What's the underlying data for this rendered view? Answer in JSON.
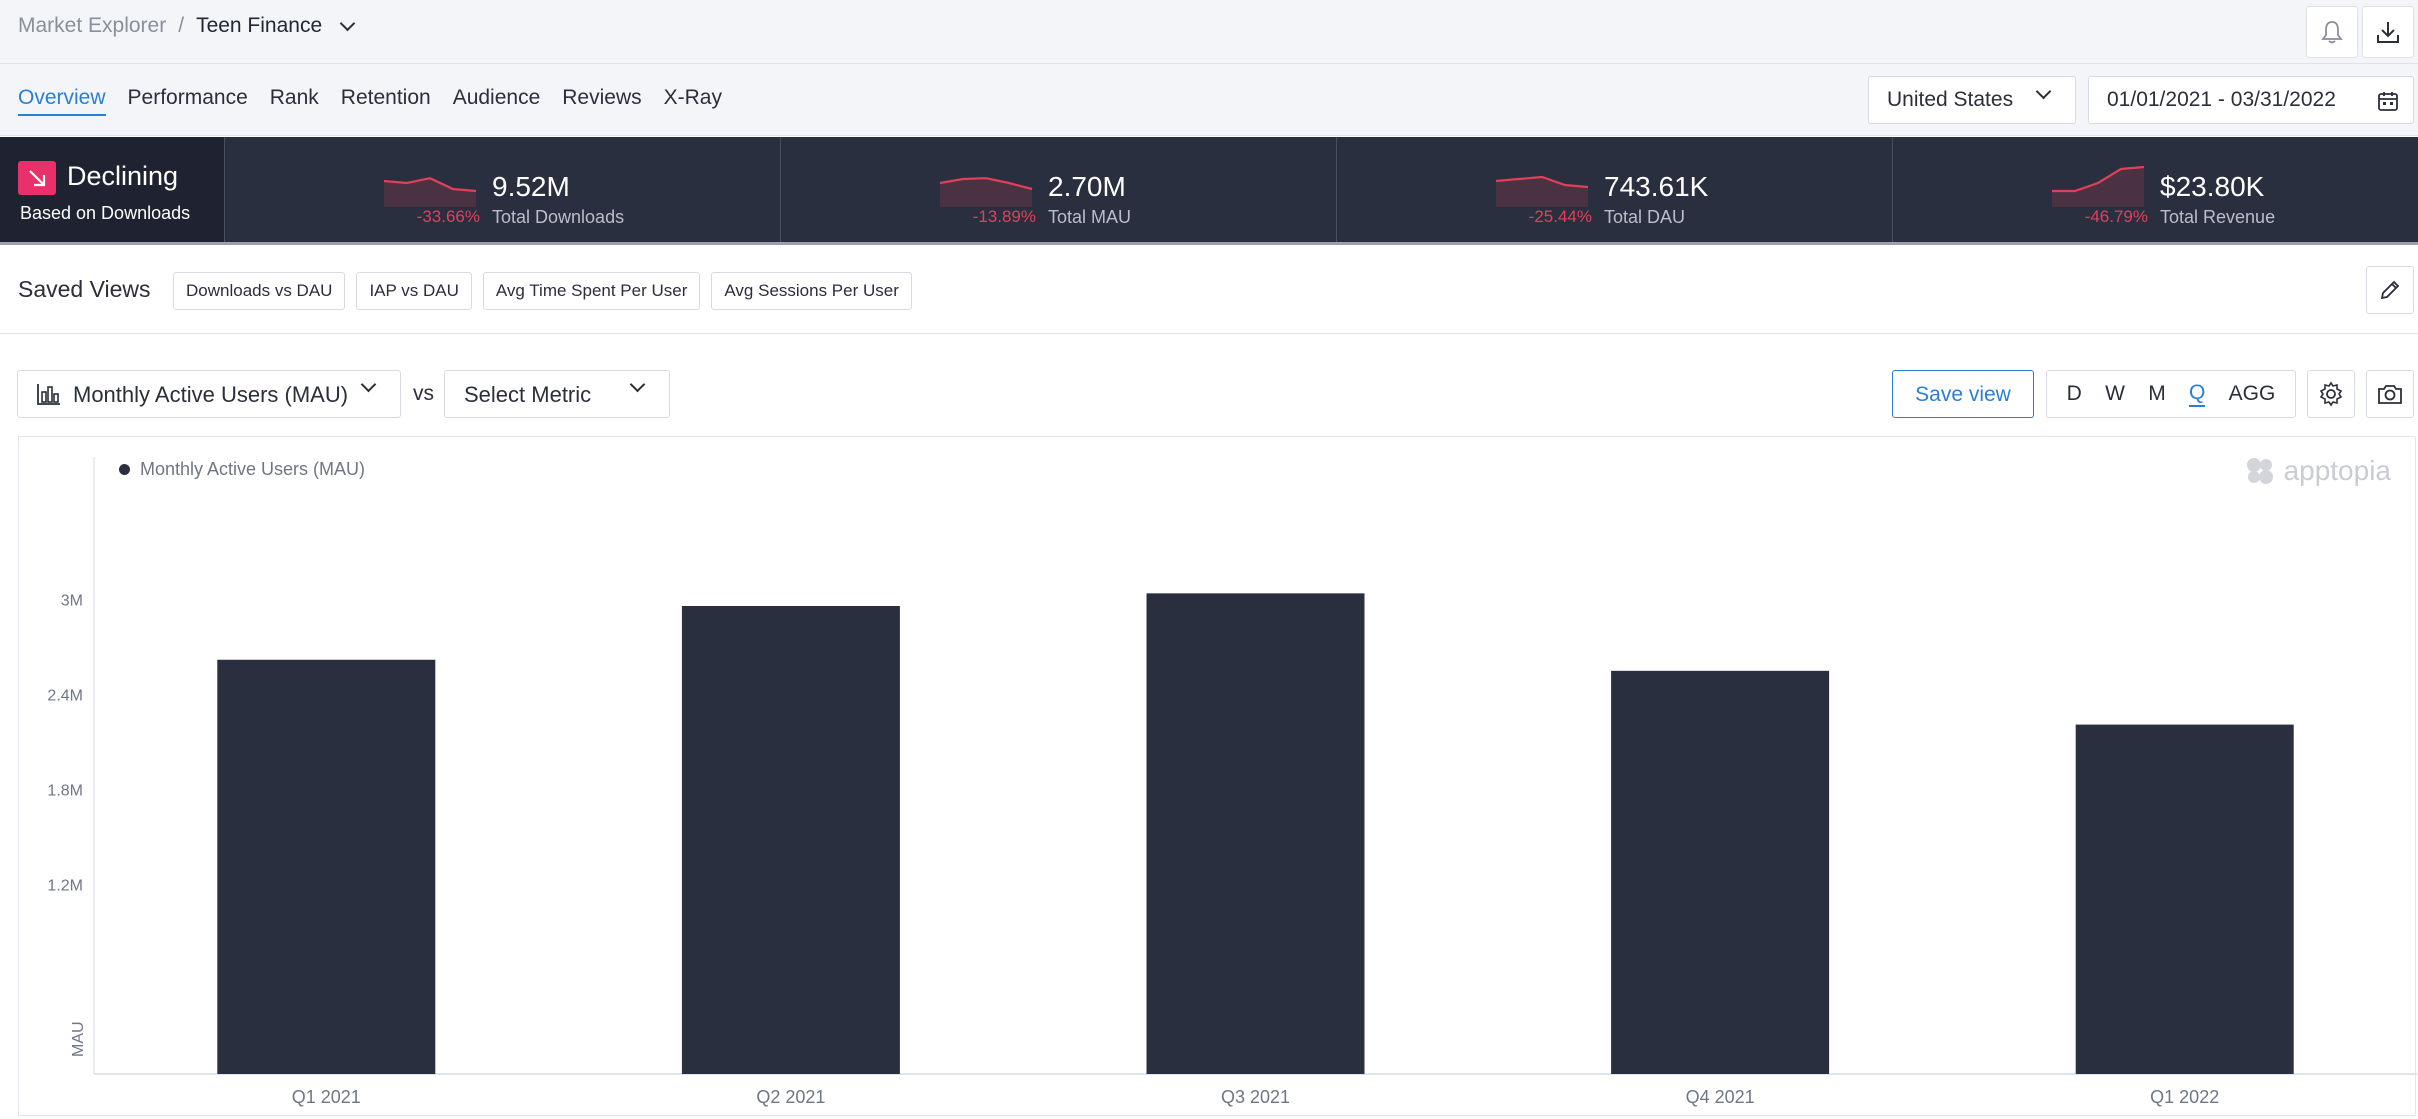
{
  "breadcrumb": {
    "root": "Market Explorer",
    "separator": "/",
    "current": "Teen Finance"
  },
  "top_icons": [
    "bell-icon",
    "download-icon"
  ],
  "tabs": [
    {
      "label": "Overview",
      "active": true
    },
    {
      "label": "Performance"
    },
    {
      "label": "Rank"
    },
    {
      "label": "Retention"
    },
    {
      "label": "Audience"
    },
    {
      "label": "Reviews"
    },
    {
      "label": "X-Ray"
    }
  ],
  "filters": {
    "country": "United States",
    "date_range": "01/01/2021 - 03/31/2022"
  },
  "trend": {
    "title": "Declining",
    "subtitle": "Based on Downloads",
    "icon": "arrow-down-right-icon",
    "color": "#e8306a"
  },
  "kpis": [
    {
      "pct": "-33.66%",
      "value": "9.52M",
      "label": "Total Downloads",
      "spark": [
        0.55,
        0.5,
        0.62,
        0.35,
        0.3
      ]
    },
    {
      "pct": "-13.89%",
      "value": "2.70M",
      "label": "Total MAU",
      "spark": [
        0.5,
        0.6,
        0.62,
        0.5,
        0.35
      ]
    },
    {
      "pct": "-25.44%",
      "value": "743.61K",
      "label": "Total DAU",
      "spark": [
        0.55,
        0.6,
        0.65,
        0.45,
        0.4
      ]
    },
    {
      "pct": "-46.79%",
      "value": "$23.80K",
      "label": "Total Revenue",
      "spark": [
        0.3,
        0.3,
        0.5,
        0.85,
        0.9
      ]
    }
  ],
  "saved_views": {
    "title": "Saved Views",
    "chips": [
      "Downloads vs DAU",
      "IAP vs DAU",
      "Avg Time Spent Per User",
      "Avg Sessions Per User"
    ]
  },
  "metric": {
    "primary": "Monthly Active Users (MAU)",
    "vs": "vs",
    "secondary": "Select Metric"
  },
  "actions": {
    "save_view": "Save view",
    "granularity": [
      "D",
      "W",
      "M",
      "Q",
      "AGG"
    ],
    "active_granularity": "Q"
  },
  "chart_data": {
    "type": "bar",
    "legend": "Monthly Active Users (MAU)",
    "watermark": "apptopia",
    "categories": [
      "Q1 2021",
      "Q2 2021",
      "Q3 2021",
      "Q4 2021",
      "Q1 2022"
    ],
    "values": [
      2620000,
      2960000,
      3040000,
      2550000,
      2210000
    ],
    "ylabel": "MAU",
    "yticks": [
      {
        "value": 1200000,
        "label": "1.2M"
      },
      {
        "value": 1800000,
        "label": "1.8M"
      },
      {
        "value": 2400000,
        "label": "2.4M"
      },
      {
        "value": 3000000,
        "label": "3M"
      }
    ],
    "ylim": [
      0,
      3700000
    ],
    "bar_color": "#2a2f3f",
    "grid": false
  },
  "colors": {
    "accent": "#2a7fd4",
    "negative": "#e0405a",
    "kpi_bg": "#2a2f3f"
  }
}
